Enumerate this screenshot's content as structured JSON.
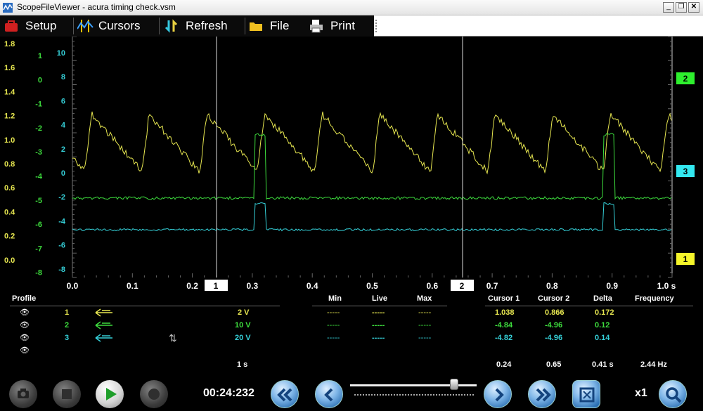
{
  "window": {
    "title": "ScopeFileViewer - acura timing check.vsm"
  },
  "toolbar": {
    "setup": "Setup",
    "cursors": "Cursors",
    "refresh": "Refresh",
    "file": "File",
    "print": "Print"
  },
  "axes": {
    "y1": [
      "1.8",
      "1.6",
      "1.4",
      "1.2",
      "1.0",
      "0.8",
      "0.6",
      "0.4",
      "0.2",
      "0.0"
    ],
    "y2": [
      "1",
      "0",
      "-1",
      "-2",
      "-3",
      "-4",
      "-5",
      "-6",
      "-7",
      "-8"
    ],
    "y3": [
      "10",
      "8",
      "6",
      "4",
      "2",
      "0",
      "-2",
      "-4",
      "-6",
      "-8"
    ],
    "x": [
      "0.0",
      "0.1",
      "0.2",
      "0.3",
      "0.4",
      "0.5",
      "0.6",
      "0.7",
      "0.8",
      "0.9",
      "1.0 s"
    ],
    "cursor1_label": "1",
    "cursor2_label": "2",
    "markers": [
      "2",
      "3",
      "1"
    ]
  },
  "colors": {
    "ch1": "#e6e650",
    "ch2": "#3ddc3d",
    "ch3": "#35d0d8"
  },
  "table": {
    "profile": "Profile",
    "min": "Min",
    "live": "Live",
    "max": "Max",
    "cursor1": "Cursor 1",
    "cursor2": "Cursor 2",
    "delta": "Delta",
    "frequency": "Frequency",
    "rows": [
      {
        "num": "1",
        "scale": "2 V",
        "min": "-----",
        "live": "-----",
        "max": "-----",
        "c1": "1.038",
        "c2": "0.866",
        "delta": "0.172"
      },
      {
        "num": "2",
        "scale": "10 V",
        "min": "-----",
        "live": "-----",
        "max": "-----",
        "c1": "-4.84",
        "c2": "-4.96",
        "delta": "0.12"
      },
      {
        "num": "3",
        "scale": "20 V",
        "min": "-----",
        "live": "-----",
        "max": "-----",
        "c1": "-4.82",
        "c2": "-4.96",
        "delta": "0.14"
      }
    ],
    "timebase": "1 s",
    "t_c1": "0.24",
    "t_c2": "0.65",
    "t_delta": "0.41 s",
    "t_freq": "2.44 Hz"
  },
  "playback": {
    "time": "00:24:232",
    "speed": "x1",
    "position": 0.82
  }
}
